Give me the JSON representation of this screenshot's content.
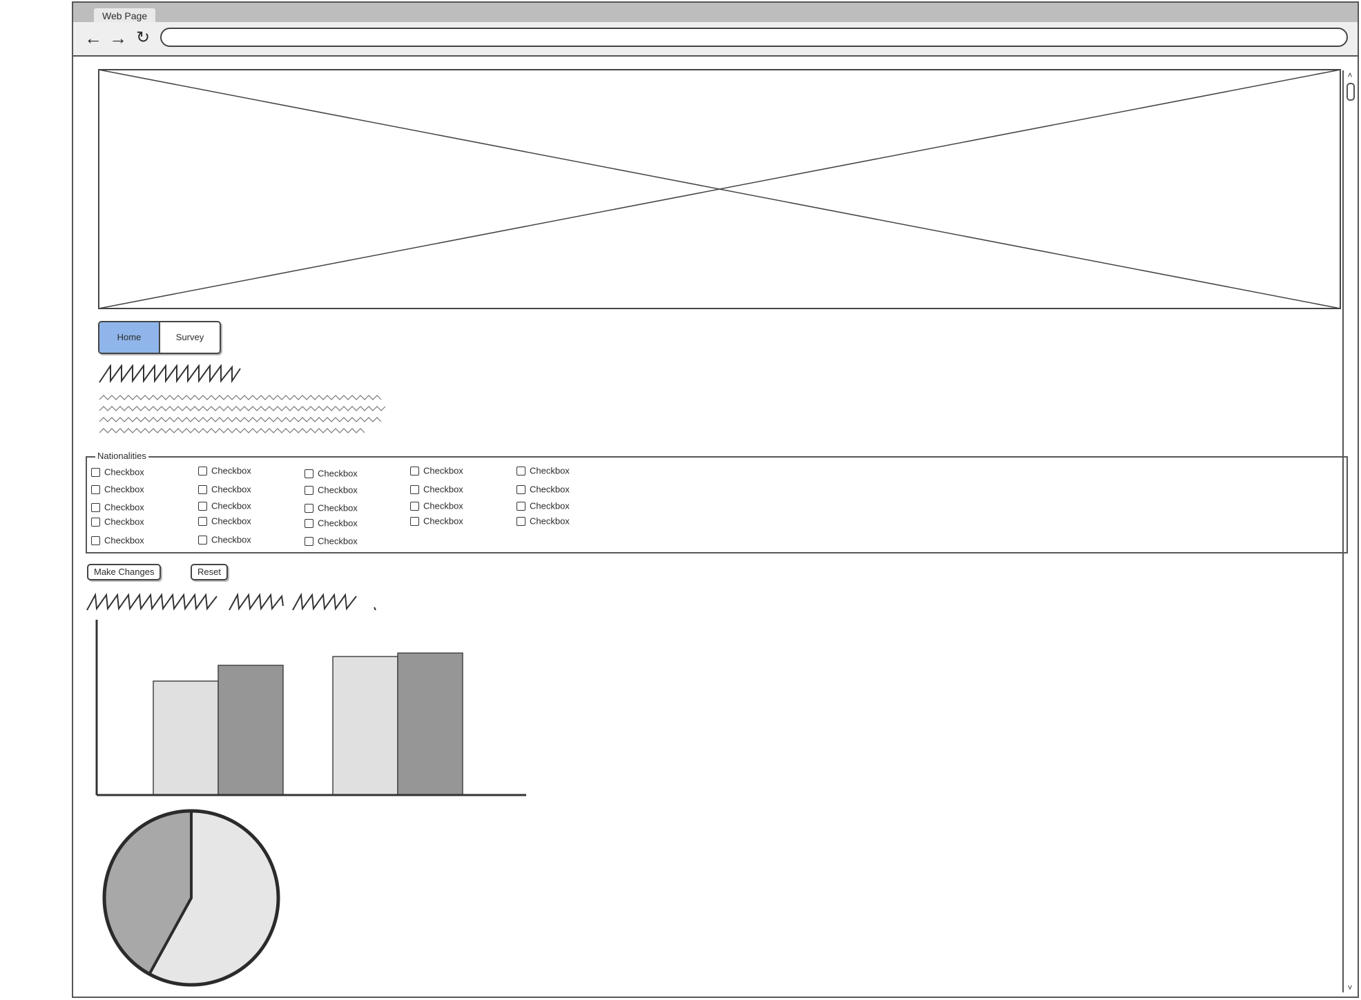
{
  "browser": {
    "tab_title": "Web Page",
    "address_value": "",
    "back_icon": "arrow-left-icon",
    "forward_icon": "arrow-right-icon",
    "reload_icon": "reload-icon"
  },
  "hero": {
    "type": "image-placeholder"
  },
  "nav": {
    "items": [
      {
        "label": "Home",
        "active": true
      },
      {
        "label": "Survey",
        "active": false
      }
    ],
    "active_color": "#8fb5ea"
  },
  "nationalities": {
    "legend": "Nationalities",
    "checkbox_label": "Checkbox",
    "columns": [
      [
        "Checkbox",
        "Checkbox",
        "Checkbox",
        "Checkbox",
        "Checkbox"
      ],
      [
        "Checkbox",
        "Checkbox",
        "Checkbox",
        "Checkbox",
        "Checkbox"
      ],
      [
        "Checkbox",
        "Checkbox",
        "Checkbox",
        "Checkbox",
        "Checkbox"
      ],
      [
        "Checkbox",
        "Checkbox",
        "Checkbox",
        "Checkbox"
      ],
      [
        "Checkbox",
        "Checkbox",
        "Checkbox",
        "Checkbox"
      ]
    ]
  },
  "actions": {
    "make_changes": "Make Changes",
    "reset": "Reset"
  },
  "chart_data": [
    {
      "type": "bar",
      "categories": [
        "",
        ""
      ],
      "series": [
        {
          "values": [
            65,
            79
          ]
        },
        {
          "values": [
            74,
            81
          ]
        }
      ],
      "ylim": [
        0,
        100
      ],
      "colors": [
        "#e0e0e0",
        "#969696"
      ]
    },
    {
      "type": "pie",
      "values": [
        58,
        42
      ],
      "colors": [
        "#e6e6e6",
        "#a8a8a8"
      ]
    }
  ]
}
